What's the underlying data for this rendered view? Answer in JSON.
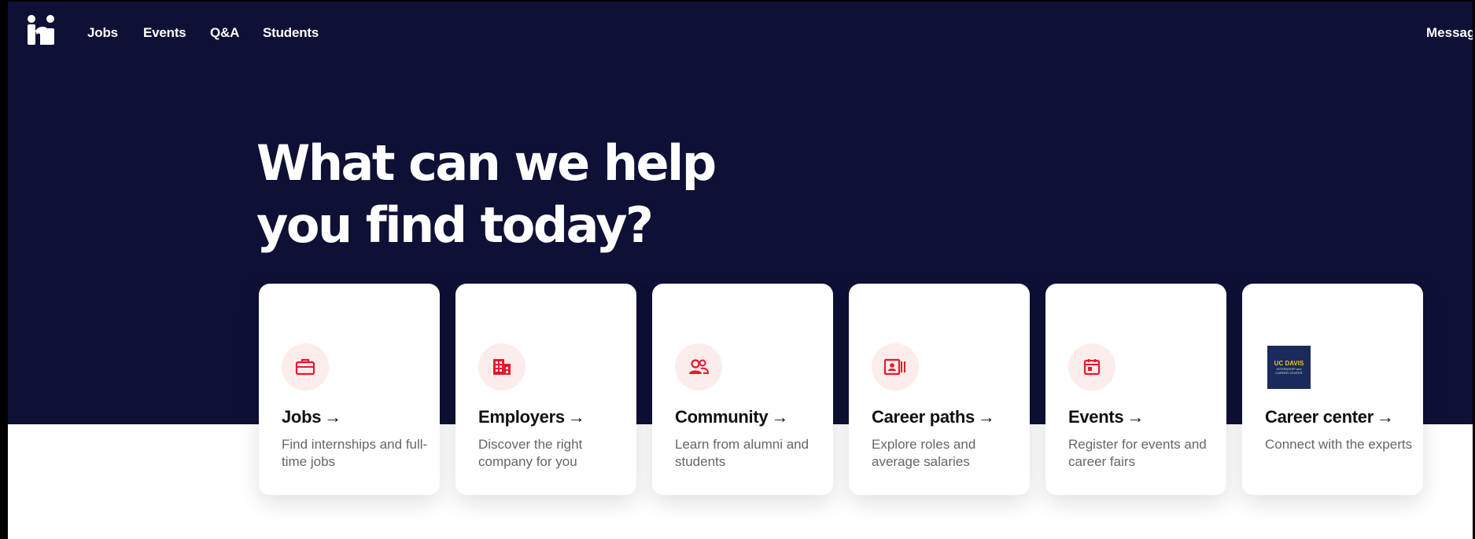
{
  "nav": {
    "links": [
      "Jobs",
      "Events",
      "Q&A",
      "Students"
    ],
    "right_link": "Messages"
  },
  "hero": {
    "headline_line1": "What can we help",
    "headline_line2": "you find today?"
  },
  "cards": [
    {
      "title": "Jobs",
      "arrow": "→",
      "desc": "Find internships and full-time jobs",
      "icon": "briefcase-icon"
    },
    {
      "title": "Employers",
      "arrow": "→",
      "desc": "Discover the right company for you",
      "icon": "building-icon"
    },
    {
      "title": "Community",
      "arrow": "→",
      "desc": "Learn from alumni and students",
      "icon": "people-icon"
    },
    {
      "title": "Career paths",
      "arrow": "→",
      "desc": "Explore roles and average salaries",
      "icon": "id-card-icon"
    },
    {
      "title": "Events",
      "arrow": "→",
      "desc": "Register for events and career fairs",
      "icon": "calendar-icon"
    },
    {
      "title": "Career center",
      "arrow": "→",
      "desc": "Connect with the experts",
      "icon": "uc-davis-logo"
    }
  ],
  "career_center_logo": {
    "line1": "UC DAVIS",
    "line2": "INTERNSHIP and CAREER CENTER"
  },
  "colors": {
    "hero_bg": "#0e1036",
    "accent": "#e8192c",
    "icon_bg": "#fdecec"
  }
}
